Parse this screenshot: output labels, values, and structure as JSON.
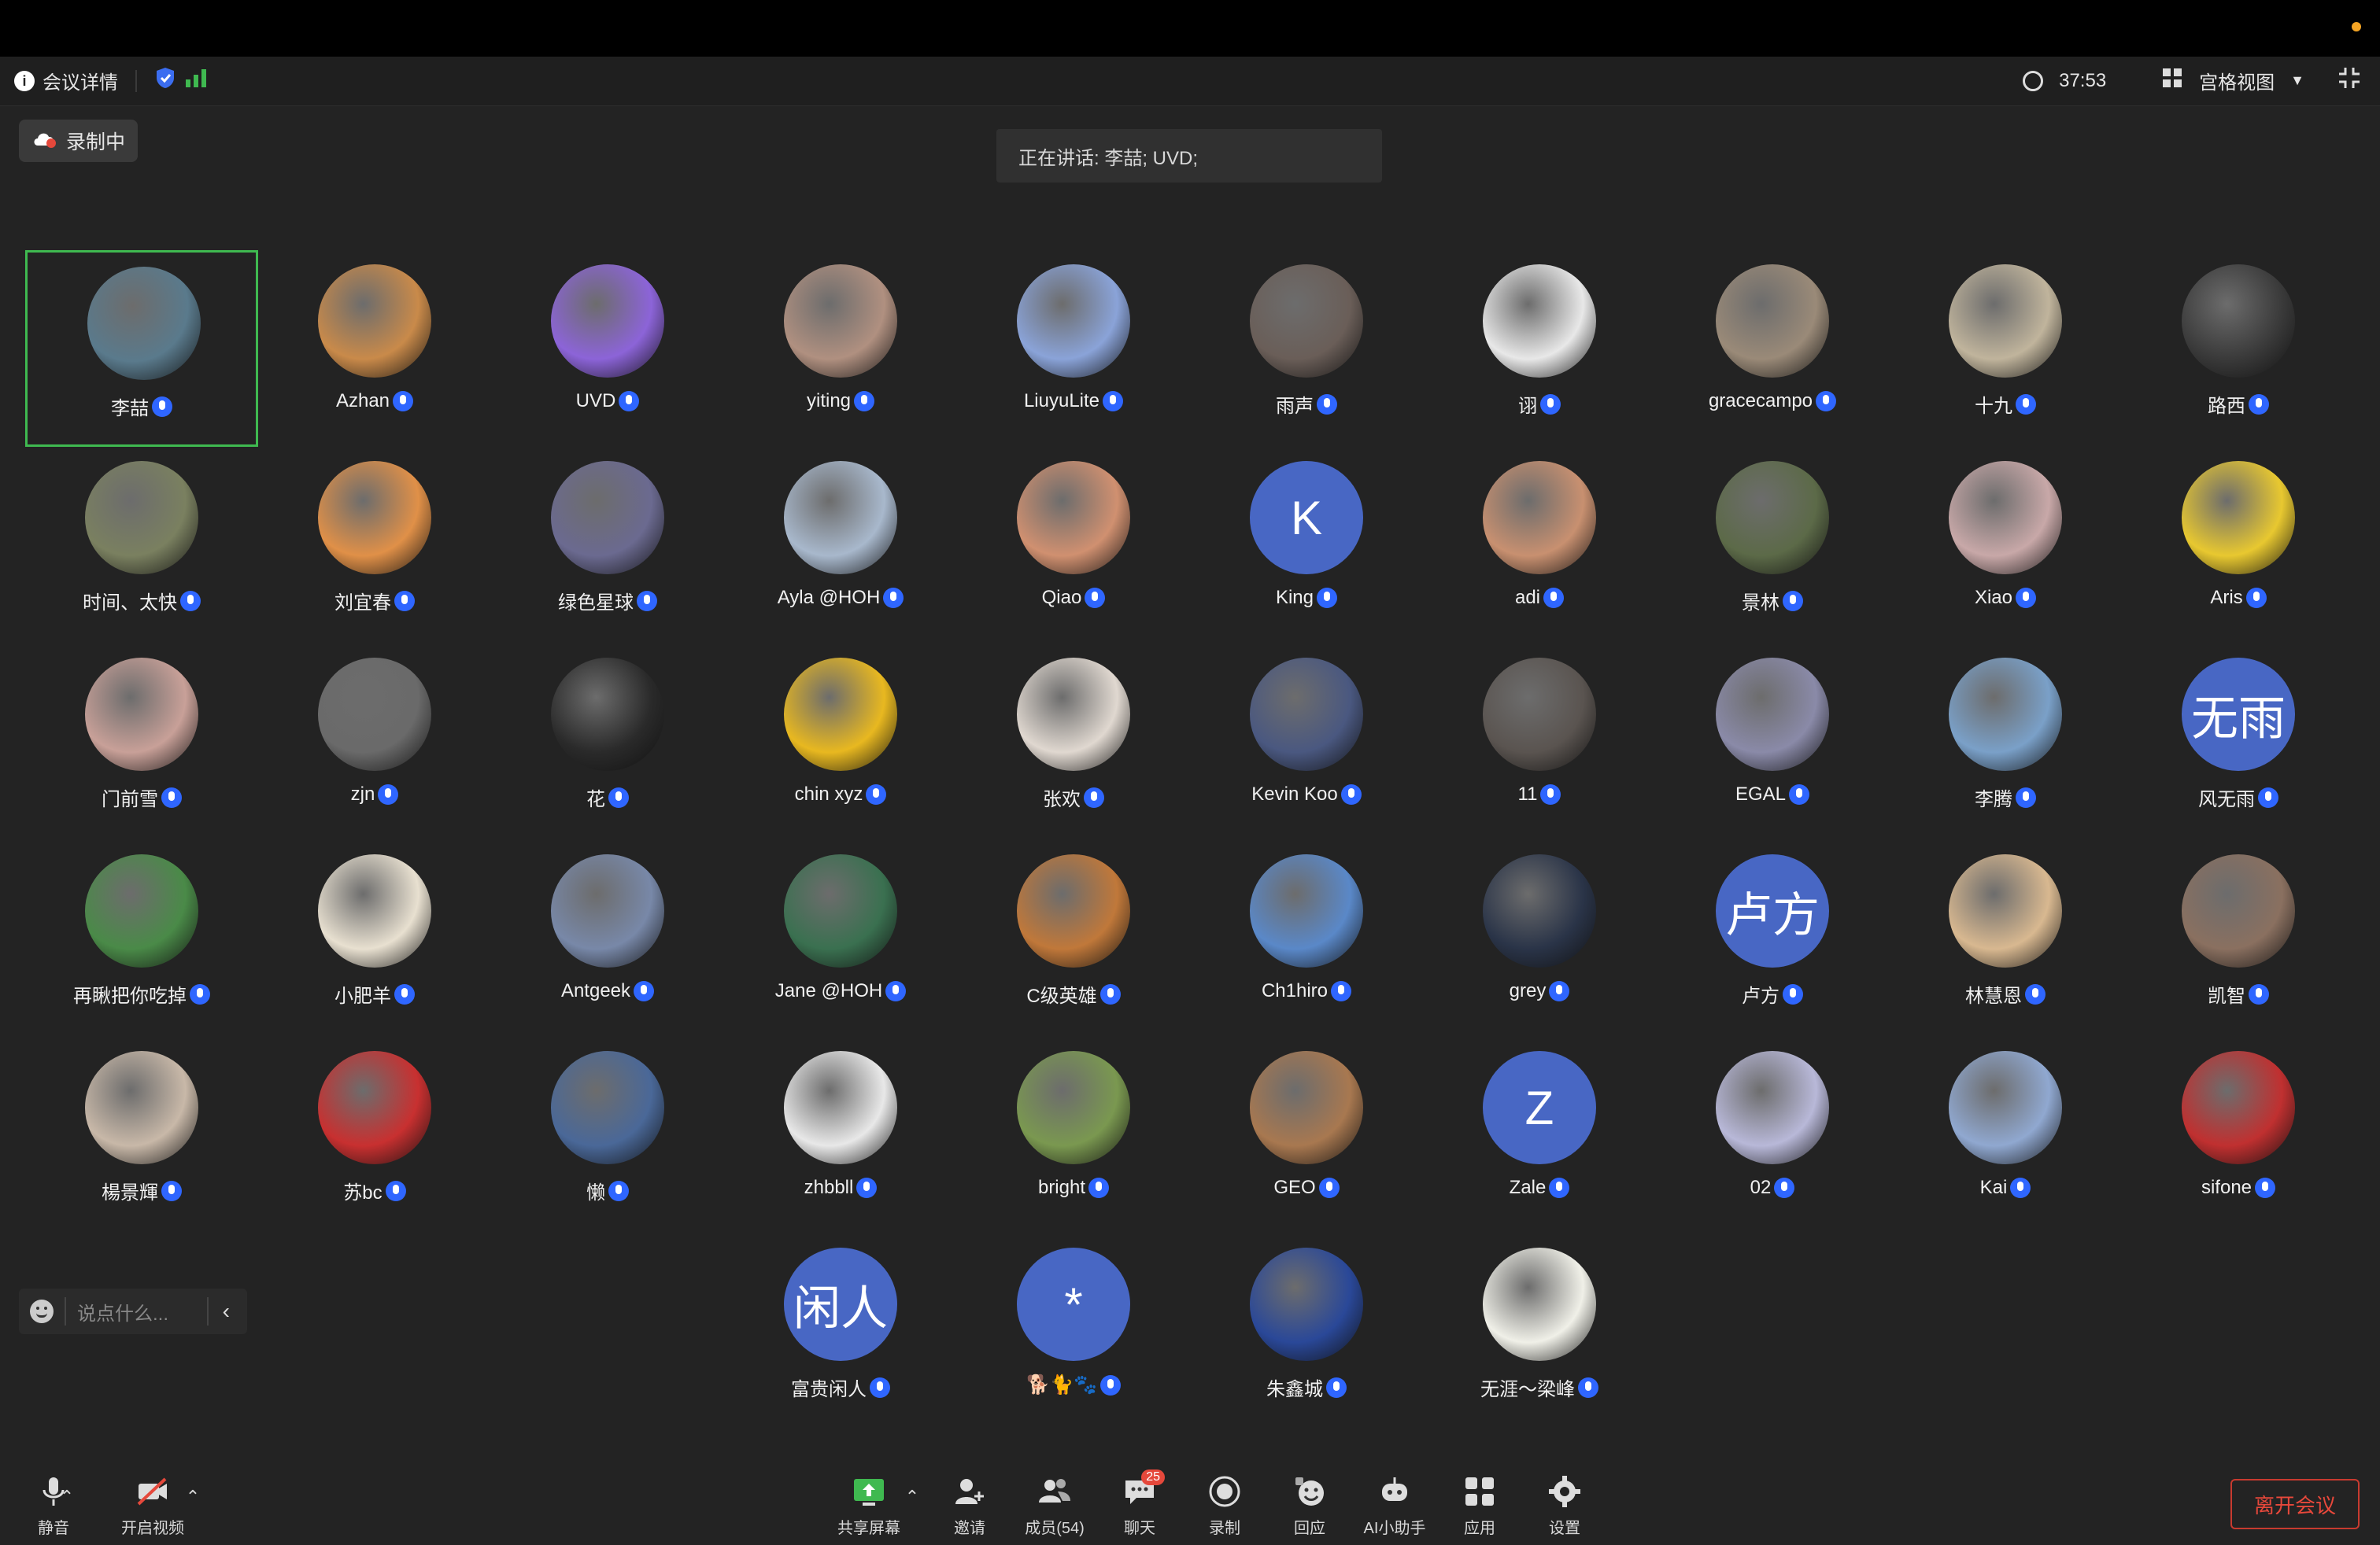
{
  "topbar": {
    "indicator_color": "#f5a524"
  },
  "infobar": {
    "meeting_details": "会议详情",
    "timer": "37:53",
    "view_mode": "宫格视图"
  },
  "recording_badge": "录制中",
  "speaking_text": "正在讲话: 李喆; UVD;",
  "chat_placeholder": "说点什么...",
  "participants": [
    {
      "name": "李喆",
      "avatar": "photo",
      "color": "#5a7a8c",
      "active": true
    },
    {
      "name": "Azhan",
      "avatar": "photo",
      "color": "#c98a4a"
    },
    {
      "name": "UVD",
      "avatar": "photo",
      "color": "#8c64d8"
    },
    {
      "name": "yiting",
      "avatar": "photo",
      "color": "#b09080"
    },
    {
      "name": "LiuyuLite",
      "avatar": "photo",
      "color": "#8aa3d8"
    },
    {
      "name": "雨声",
      "avatar": "photo",
      "color": "#6a5e58"
    },
    {
      "name": "诩",
      "avatar": "photo",
      "color": "#e8e8e8"
    },
    {
      "name": "gracecampo",
      "avatar": "photo",
      "color": "#9a8a78"
    },
    {
      "name": "十九",
      "avatar": "photo",
      "color": "#c0b49c"
    },
    {
      "name": "路西",
      "avatar": "photo",
      "color": "#3a3a3a"
    },
    {
      "name": "时间、太快",
      "avatar": "photo",
      "color": "#7a8060"
    },
    {
      "name": "刘宜春",
      "avatar": "photo",
      "color": "#e09048"
    },
    {
      "name": "绿色星球",
      "avatar": "photo",
      "color": "#6b6a90"
    },
    {
      "name": "Ayla @HOH",
      "avatar": "photo",
      "color": "#a8b8cc"
    },
    {
      "name": "Qiao",
      "avatar": "photo",
      "color": "#d09070"
    },
    {
      "name": "King",
      "avatar": "letter",
      "letter": "K",
      "color": "#4867c4"
    },
    {
      "name": "adi",
      "avatar": "photo",
      "color": "#c89070"
    },
    {
      "name": "景林",
      "avatar": "photo",
      "color": "#5c6a48"
    },
    {
      "name": "Xiao",
      "avatar": "photo",
      "color": "#c8a8a8"
    },
    {
      "name": "Aris",
      "avatar": "photo",
      "color": "#e8c830"
    },
    {
      "name": "门前雪",
      "avatar": "photo",
      "color": "#c8a098"
    },
    {
      "name": "zjn",
      "avatar": "photo",
      "color": "#6a6a6a"
    },
    {
      "name": "花",
      "avatar": "photo",
      "color": "#2a2a2a"
    },
    {
      "name": "chin xyz",
      "avatar": "photo",
      "color": "#e8b820"
    },
    {
      "name": "张欢",
      "avatar": "photo",
      "color": "#e0d8d0"
    },
    {
      "name": "Kevin Koo",
      "avatar": "photo",
      "color": "#4a5880"
    },
    {
      "name": "11",
      "avatar": "photo",
      "color": "#5a5450"
    },
    {
      "name": "EGAL",
      "avatar": "photo",
      "color": "#8a8aa8"
    },
    {
      "name": "李腾",
      "avatar": "photo",
      "color": "#7aa0c8"
    },
    {
      "name": "风无雨",
      "avatar": "letter",
      "letter": "无雨",
      "color": "#4867c4"
    },
    {
      "name": "再瞅把你吃掉",
      "avatar": "photo",
      "color": "#4a8a48"
    },
    {
      "name": "小肥羊",
      "avatar": "photo",
      "color": "#e8e0d0"
    },
    {
      "name": "Antgeek",
      "avatar": "photo",
      "color": "#7888a8"
    },
    {
      "name": "Jane @HOH",
      "avatar": "photo",
      "color": "#3a7050"
    },
    {
      "name": "C级英雄",
      "avatar": "photo",
      "color": "#c0783a"
    },
    {
      "name": "Ch1hiro",
      "avatar": "photo",
      "color": "#5a88c8"
    },
    {
      "name": "grey",
      "avatar": "photo",
      "color": "#2a3448"
    },
    {
      "name": "卢方",
      "avatar": "letter",
      "letter": "卢方",
      "color": "#4867c4"
    },
    {
      "name": "林慧恩",
      "avatar": "photo",
      "color": "#d8b890"
    },
    {
      "name": "凯智",
      "avatar": "photo",
      "color": "#8a7060"
    },
    {
      "name": "楊景輝",
      "avatar": "photo",
      "color": "#c8b8a8"
    },
    {
      "name": "苏bc",
      "avatar": "photo",
      "color": "#c83030"
    },
    {
      "name": "懒",
      "avatar": "photo",
      "color": "#4a6898"
    },
    {
      "name": "zhbbll",
      "avatar": "photo",
      "color": "#e8e8e8"
    },
    {
      "name": "bright",
      "avatar": "photo",
      "color": "#7a9850"
    },
    {
      "name": "GEO",
      "avatar": "photo",
      "color": "#a87850"
    },
    {
      "name": "Zale",
      "avatar": "letter",
      "letter": "Z",
      "color": "#4867c4"
    },
    {
      "name": "02",
      "avatar": "photo",
      "color": "#b8b8d8"
    },
    {
      "name": "Kai",
      "avatar": "photo",
      "color": "#90a8d0"
    },
    {
      "name": "sifone",
      "avatar": "photo",
      "color": "#c03030"
    },
    {
      "name": "富贵闲人",
      "avatar": "letter",
      "letter": "闲人",
      "color": "#4867c4"
    },
    {
      "name": "🐕🐈🐾",
      "avatar": "letter",
      "letter": "*",
      "color": "#4867c4"
    },
    {
      "name": "朱鑫城",
      "avatar": "photo",
      "color": "#2a4898"
    },
    {
      "name": "无涯～梁峰",
      "avatar": "photo",
      "color": "#f0f0e8"
    }
  ],
  "toolbar": {
    "mute": "静音",
    "video": "开启视频",
    "share": "共享屏幕",
    "invite": "邀请",
    "members": "成员(54)",
    "chat": "聊天",
    "chat_badge": "25",
    "record": "录制",
    "review": "回应",
    "ai_assistant": "AI小助手",
    "apps": "应用",
    "settings": "设置",
    "leave": "离开会议"
  }
}
